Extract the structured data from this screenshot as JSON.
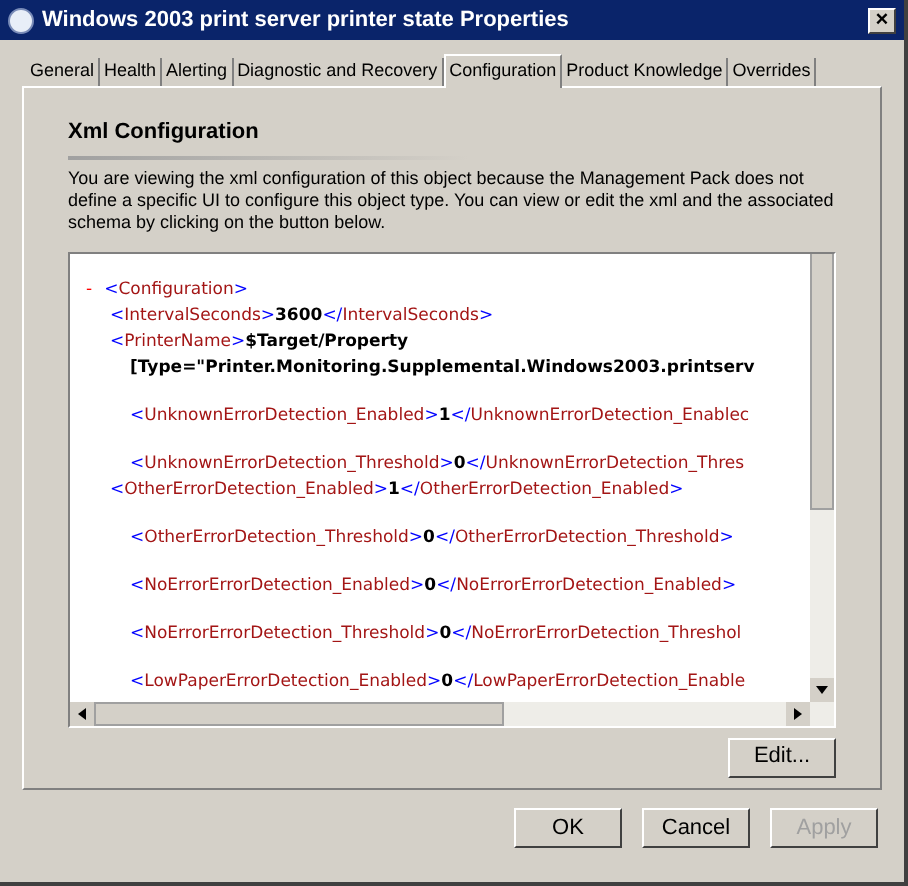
{
  "window": {
    "title": "Windows 2003 print server printer state Properties",
    "close": "×"
  },
  "tabs": [
    {
      "label": "General",
      "selected": false
    },
    {
      "label": "Health",
      "selected": false
    },
    {
      "label": "Alerting",
      "selected": false
    },
    {
      "label": "Diagnostic and Recovery",
      "selected": false
    },
    {
      "label": "Configuration",
      "selected": true
    },
    {
      "label": "Product Knowledge",
      "selected": false
    },
    {
      "label": "Overrides",
      "selected": false
    }
  ],
  "section_title": "Xml Configuration",
  "description": "You are viewing the xml configuration of this object because the Management Pack does not define a specific UI to configure this object type. You can view or edit the xml and the associated schema by clicking on the button below.",
  "xml_lines": [
    {
      "kind": "root",
      "toggle": "-",
      "open": "<Configuration>"
    },
    {
      "kind": "child",
      "open": "<IntervalSeconds>",
      "value": "3600",
      "close": "</IntervalSeconds>",
      "closed": true
    },
    {
      "kind": "child",
      "open": "<PrinterName>",
      "value": "$Target/Property"
    },
    {
      "kind": "continuation",
      "value": "[Type=\"Printer.Monitoring.Supplemental.Windows2003.printserv"
    },
    {
      "kind": "gap"
    },
    {
      "kind": "grandchild",
      "open": "<UnknownErrorDetection_Enabled>",
      "value": "1",
      "close": "</UnknownErrorDetection_Enablec",
      "closed": false
    },
    {
      "kind": "gap"
    },
    {
      "kind": "grandchild",
      "open": "<UnknownErrorDetection_Threshold>",
      "value": "0",
      "close": "</UnknownErrorDetection_Thres",
      "closed": false
    },
    {
      "kind": "child",
      "open": "<OtherErrorDetection_Enabled>",
      "value": "1",
      "close": "</OtherErrorDetection_Enabled>",
      "closed": true
    },
    {
      "kind": "gap"
    },
    {
      "kind": "grandchild",
      "open": "<OtherErrorDetection_Threshold>",
      "value": "0",
      "close": "</OtherErrorDetection_Threshold>",
      "closed": true
    },
    {
      "kind": "gap"
    },
    {
      "kind": "grandchild",
      "open": "<NoErrorErrorDetection_Enabled>",
      "value": "0",
      "close": "</NoErrorErrorDetection_Enabled>",
      "closed": true
    },
    {
      "kind": "gap"
    },
    {
      "kind": "grandchild",
      "open": "<NoErrorErrorDetection_Threshold>",
      "value": "0",
      "close": "</NoErrorErrorDetection_Threshol",
      "closed": false
    },
    {
      "kind": "gap"
    },
    {
      "kind": "grandchild",
      "open": "<LowPaperErrorDetection_Enabled>",
      "value": "0",
      "close": "</LowPaperErrorDetection_Enable",
      "closed": false
    }
  ],
  "edit_button": {
    "label": "Edit...",
    "disabled": false
  },
  "buttons": [
    {
      "label": "OK",
      "disabled": false
    },
    {
      "label": "Cancel",
      "disabled": false
    },
    {
      "label": "Apply",
      "disabled": true
    }
  ]
}
